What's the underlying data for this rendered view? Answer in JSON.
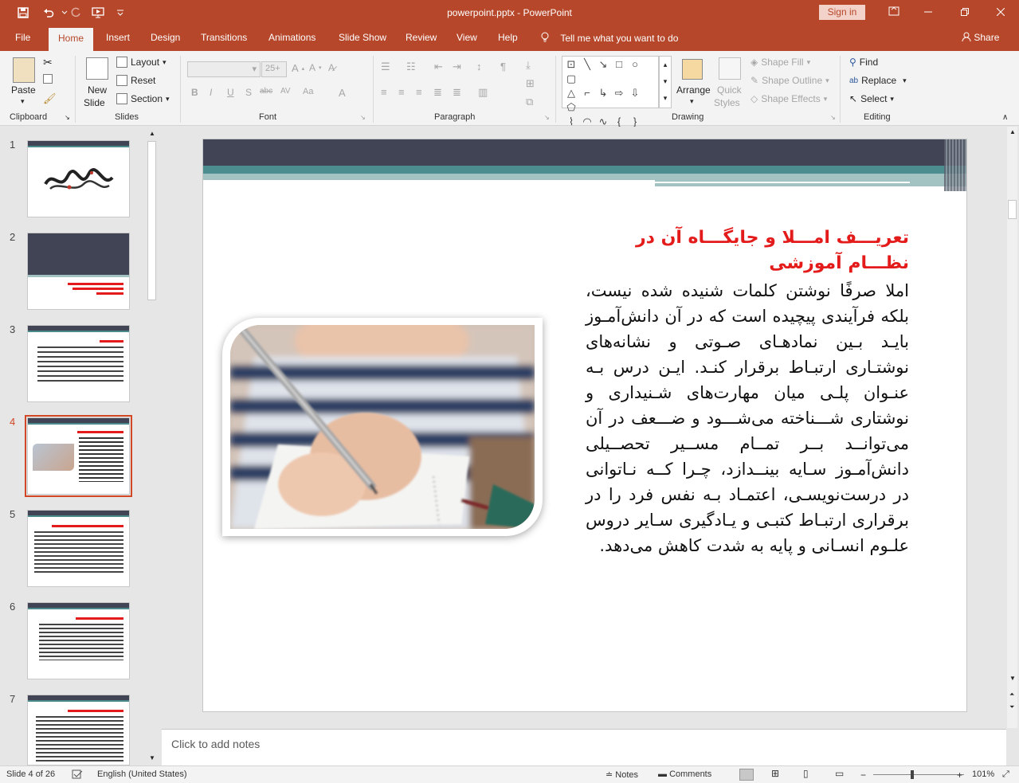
{
  "window": {
    "title": "powerpoint.pptx - PowerPoint",
    "sign_in": "Sign in"
  },
  "tabs": [
    {
      "label": "File"
    },
    {
      "label": "Home"
    },
    {
      "label": "Insert"
    },
    {
      "label": "Design"
    },
    {
      "label": "Transitions"
    },
    {
      "label": "Animations"
    },
    {
      "label": "Slide Show"
    },
    {
      "label": "Review"
    },
    {
      "label": "View"
    },
    {
      "label": "Help"
    }
  ],
  "tell_me": "Tell me what you want to do",
  "share": "Share",
  "ribbon": {
    "clipboard": {
      "label": "Clipboard",
      "paste": "Paste"
    },
    "slides": {
      "label": "Slides",
      "new_slide_1": "New",
      "new_slide_2": "Slide",
      "layout": "Layout",
      "reset": "Reset",
      "section": "Section"
    },
    "font": {
      "label": "Font",
      "size": "25+"
    },
    "paragraph": {
      "label": "Paragraph"
    },
    "drawing": {
      "label": "Drawing",
      "arrange": "Arrange",
      "quick_styles_1": "Quick",
      "quick_styles_2": "Styles",
      "shape_fill": "Shape Fill",
      "shape_outline": "Shape Outline",
      "shape_effects": "Shape Effects"
    },
    "editing": {
      "label": "Editing",
      "find": "Find",
      "replace": "Replace",
      "select": "Select"
    }
  },
  "thumbnails": [
    {
      "num": "1"
    },
    {
      "num": "2"
    },
    {
      "num": "3"
    },
    {
      "num": "4"
    },
    {
      "num": "5"
    },
    {
      "num": "6"
    },
    {
      "num": "7"
    }
  ],
  "slide": {
    "title": "تعریـــف امـــلا و جایگـــاه آن در نظـــام آموزشی",
    "body": "املا صرفًا نوشتن کلمات شنیده شده نیست، بلکه فرآیندی پیچیده است که در آن دانش‌آمـوز بایـد بـین نمادهـای صـوتی و نشانه‌های نوشتـاری ارتبـاط برقرار کنـد. ایـن درس بـه عنـوان پلـی میان مهارت‌های شـنیداری و نوشتاری شـــناخته می‌شـــود و ضـــعف در آن می‌توانــد بــر تمــام مســیر تحصــیلی دانش‌آمـوز سـایه بینــدازد، چـرا کــه نـاتوانی در درست‌نویسـی، اعتمـاد بـه نفس فرد را در برقراری ارتبـاط کتبـی و یـادگیری سـایر دروس علـوم انسـانی و پایه به شدت کاهش می‌دهد."
  },
  "notes_placeholder": "Click to add notes",
  "status": {
    "slide_counter": "Slide 4 of 26",
    "language": "English (United States)",
    "notes": "Notes",
    "comments": "Comments",
    "zoom": "101%"
  }
}
